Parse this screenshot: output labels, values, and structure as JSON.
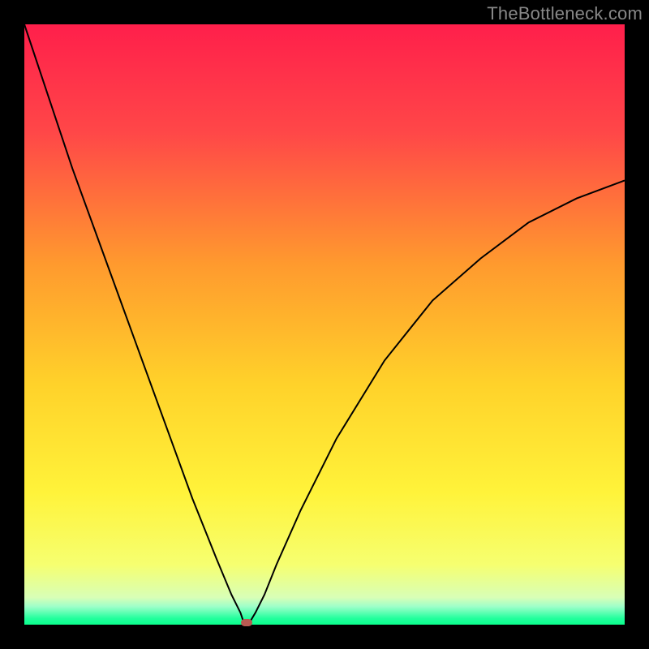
{
  "watermark": {
    "text": "TheBottleneck.com"
  },
  "colors": {
    "frame": "#000000",
    "curve_stroke": "#000000",
    "marker_fill": "#b85a52",
    "gradient_stops": [
      {
        "pct": 0,
        "color": "#ff1f4b"
      },
      {
        "pct": 18,
        "color": "#ff4748"
      },
      {
        "pct": 40,
        "color": "#ff9a2e"
      },
      {
        "pct": 60,
        "color": "#ffd22a"
      },
      {
        "pct": 78,
        "color": "#fff33a"
      },
      {
        "pct": 90,
        "color": "#f6ff70"
      },
      {
        "pct": 95.5,
        "color": "#d8ffb7"
      },
      {
        "pct": 97,
        "color": "#9dffc9"
      },
      {
        "pct": 99,
        "color": "#20ff9c"
      },
      {
        "pct": 100,
        "color": "#0bff8d"
      }
    ]
  },
  "chart_data": {
    "type": "line",
    "title": "",
    "xlabel": "",
    "ylabel": "",
    "xlim": [
      0,
      100
    ],
    "ylim": [
      0,
      100
    ],
    "grid": false,
    "legend": false,
    "series": [
      {
        "name": "bottleneck-curve",
        "x": [
          0,
          4,
          8,
          12,
          16,
          20,
          24,
          28,
          32,
          34.5,
          36,
          36.5,
          37,
          37.6,
          38.5,
          40,
          42,
          46,
          52,
          60,
          68,
          76,
          84,
          92,
          100
        ],
        "y": [
          100,
          88,
          76,
          65,
          54,
          43,
          32,
          21,
          11,
          5,
          2,
          0.5,
          0.2,
          0.5,
          2,
          5,
          10,
          19,
          31,
          44,
          54,
          61,
          67,
          71,
          74
        ]
      }
    ],
    "annotations": [
      {
        "name": "min-marker",
        "x": 37,
        "y": 0,
        "color": "#b85a52"
      }
    ],
    "notes": "Axes have no visible ticks or labels; plot sits on a black frame with a vertical rainbow gradient background. y-values are estimated from curve geometry (0–100 scale)."
  }
}
